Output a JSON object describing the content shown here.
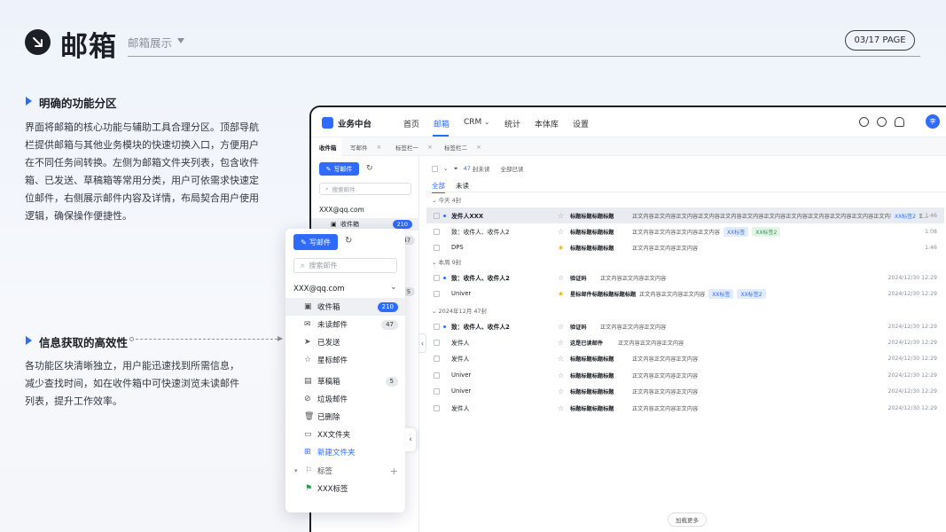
{
  "header": {
    "title": "邮箱",
    "subtitle": "邮箱展示",
    "page": "03/17 PAGE"
  },
  "sections": [
    {
      "title": "明确的功能分区",
      "body": [
        "界面将邮箱的核心功能与辅助工具合理分区。顶部导航",
        "栏提供邮箱与其他业务模块的快速切换入口，方便用户",
        "在不同任务间转换。左侧为邮箱文件夹列表，包含收件",
        "箱、已发送、草稿箱等常用分类，用户可依需求快速定",
        "位邮件，右侧展示邮件内容及详情，布局契合用户使用",
        "逻辑，确保操作便捷性。"
      ]
    },
    {
      "title": "信息获取的高效性",
      "body": [
        "各功能区块清晰独立，用户能迅速找到所需信息，",
        "减少查找时间，如在收件箱中可快速浏览未读邮件",
        "列表，提升工作效率。"
      ]
    }
  ],
  "app": {
    "brand": "业务中台",
    "nav": [
      "首页",
      "邮箱",
      "CRM",
      "统计",
      "本体库",
      "设置"
    ],
    "avatar": "李",
    "tabs": [
      "收件箱",
      "写邮件",
      "标签栏一",
      "标签栏二"
    ],
    "compose": "写邮件",
    "search_placeholder": "搜索邮件",
    "account": "XXX@qq.com",
    "inbox_label": "收件箱",
    "inbox_count": "210",
    "hidden_count_1": "47",
    "hidden_count_2": "5",
    "toolbar": {
      "unread_count": "47",
      "unread_label": "封未读",
      "mark_all": "全部已读"
    },
    "filters": [
      "全部",
      "未读"
    ],
    "groups": [
      "今天 4封",
      "本周 9封",
      "2024年12月 47封"
    ],
    "load_more": "加载更多",
    "rows": [
      {
        "sender": "发件人XXX",
        "bold": true,
        "unread": true,
        "star": false,
        "subject": "标题标题标题标题",
        "preview": "正文内容正文内容正文内容正文内容正文内容正文内容正文内容正文内容正文内容正文内容正文内容正文内容正文内容正...",
        "tags": [
          {
            "t": "XX标签2",
            "c": "b"
          }
        ],
        "time": "1:46"
      },
      {
        "sender": "致：收件人、收件人2",
        "bold": false,
        "unread": false,
        "star": false,
        "subject": "标题标题标题标题",
        "preview": "正文内容正文内容正文内容正文内容",
        "tags": [
          {
            "t": "XX标签",
            "c": "b"
          },
          {
            "t": "XX标签2",
            "c": "g"
          }
        ],
        "time": "1:08"
      },
      {
        "sender": "DPS",
        "bold": false,
        "unread": false,
        "star": true,
        "subject": "标题标题标题标题",
        "preview": "正文内容正文内容正文内容",
        "tags": [],
        "time": "1:46"
      },
      {
        "sender": "致：收件人、收件人2",
        "bold": true,
        "unread": true,
        "star": false,
        "subject": "验证码",
        "preview": "正文内容正文内容正文内容",
        "tags": [],
        "time": "2024/12/30 12:29"
      },
      {
        "sender": "Univer",
        "bold": false,
        "unread": false,
        "star": true,
        "subject": "星标邮件标题标题标题标题",
        "preview": "正文内容正文内容正文内容",
        "tags": [
          {
            "t": "XX标签",
            "c": "b"
          },
          {
            "t": "XX标签2",
            "c": "b"
          }
        ],
        "time": "2024/12/30 12:29"
      },
      {
        "sender": "致：收件人、收件人2",
        "bold": true,
        "unread": true,
        "star": false,
        "subject": "验证码",
        "preview": "正文内容正文内容正文内容",
        "tags": [],
        "time": "2024/12/30 12:29"
      },
      {
        "sender": "发件人",
        "bold": false,
        "unread": false,
        "star": false,
        "subject": "这是已读邮件",
        "preview": "正文内容正文内容正文内容",
        "tags": [],
        "time": "2024/12/30 12:29"
      },
      {
        "sender": "发件人",
        "bold": false,
        "unread": false,
        "star": false,
        "subject": "标题标题标题标题",
        "preview": "正文内容正文内容正文内容",
        "tags": [],
        "time": "2024/12/30 12:29"
      },
      {
        "sender": "Univer",
        "bold": false,
        "unread": false,
        "star": false,
        "subject": "标题标题标题标题",
        "preview": "正文内容正文内容正文内容",
        "tags": [],
        "time": "2024/12/30 12:29"
      },
      {
        "sender": "Univer",
        "bold": false,
        "unread": false,
        "star": false,
        "subject": "标题标题标题标题",
        "preview": "正文内容正文内容正文内容",
        "tags": [],
        "time": "2024/12/30 12:29"
      },
      {
        "sender": "发件人",
        "bold": false,
        "unread": false,
        "star": false,
        "subject": "标题标题标题标题",
        "preview": "正文内容正文内容正文内容",
        "tags": [],
        "time": "2024/12/30 12:29"
      }
    ]
  },
  "panel": {
    "compose": "写邮件",
    "search_placeholder": "搜索邮件",
    "account": "XXX@qq.com",
    "folders": [
      {
        "label": "收件箱",
        "count": "210",
        "count_style": "blue",
        "selected": true,
        "icon": "inbox-icon"
      },
      {
        "label": "未读邮件",
        "count": "47",
        "count_style": "gray",
        "selected": false,
        "icon": "mail-icon"
      },
      {
        "label": "已发送",
        "count": "",
        "count_style": "",
        "selected": false,
        "icon": "send-icon"
      },
      {
        "label": "星标邮件",
        "count": "",
        "count_style": "",
        "selected": false,
        "icon": "star-icon"
      },
      {
        "label": "草稿箱",
        "count": "5",
        "count_style": "gray",
        "selected": false,
        "icon": "draft-icon"
      },
      {
        "label": "垃圾邮件",
        "count": "",
        "count_style": "",
        "selected": false,
        "icon": "spam-icon"
      },
      {
        "label": "已删除",
        "count": "",
        "count_style": "",
        "selected": false,
        "icon": "trash-icon"
      },
      {
        "label": "XX文件夹",
        "count": "",
        "count_style": "",
        "selected": false,
        "icon": "folder-icon"
      },
      {
        "label": "新建文件夹",
        "count": "",
        "count_style": "",
        "selected": false,
        "icon": "new-folder-icon",
        "blue": true
      }
    ],
    "tags_label": "标签",
    "tag_item": "XXX标签"
  },
  "colors": {
    "accent": "#2f6bff",
    "star": "#f2b600",
    "tag_green": "#1d9a4a"
  }
}
